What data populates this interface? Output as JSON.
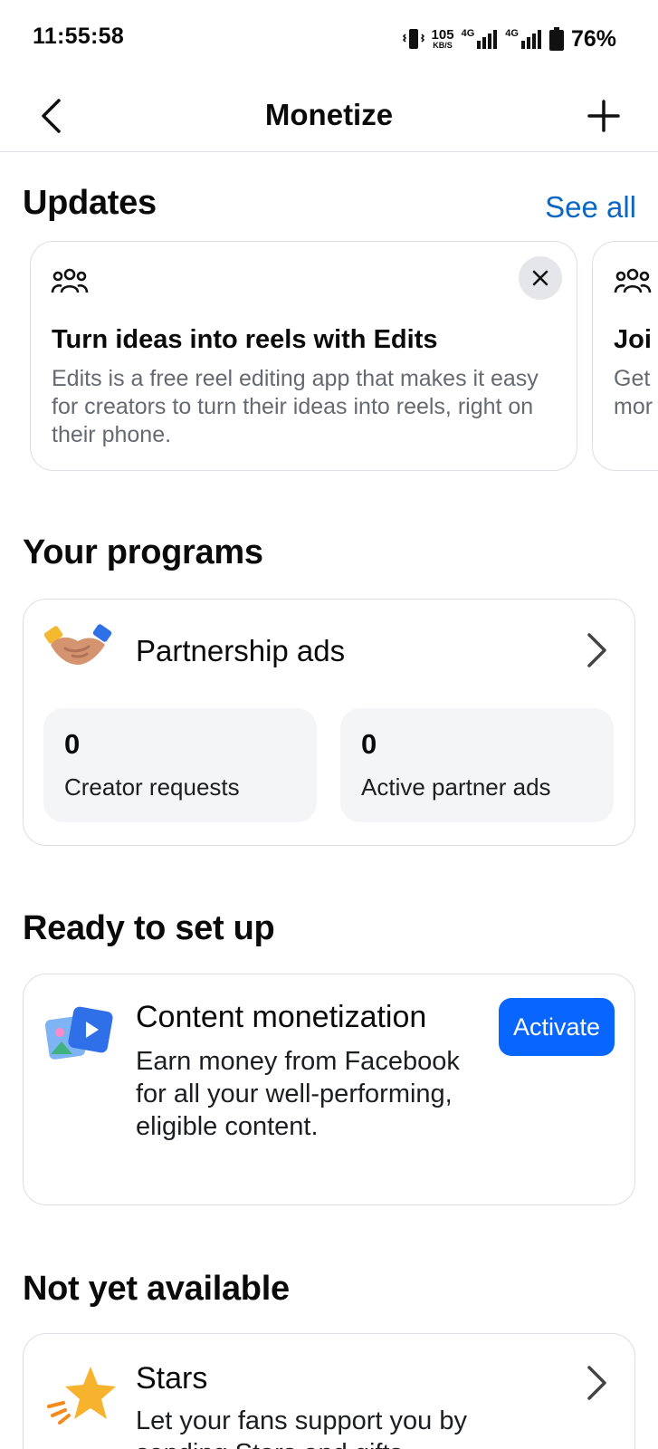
{
  "status_bar": {
    "time": "11:55:58",
    "net_speed_value": "105",
    "net_speed_unit": "KB/S",
    "signal1_label": "4G",
    "signal2_label": "4G",
    "battery_percent": "76%"
  },
  "header": {
    "title": "Monetize",
    "back_icon": "chevron-left-icon",
    "add_icon": "plus-icon"
  },
  "updates": {
    "heading": "Updates",
    "see_all_label": "See all",
    "cards": [
      {
        "icon": "group-icon",
        "title": "Turn ideas into reels with Edits",
        "body": "Edits is a free reel editing app that makes it easy for creators to turn their ideas into reels, right on their phone."
      },
      {
        "icon": "group-icon",
        "title": "Joi",
        "body_line1": "Get",
        "body_line2": "mor"
      }
    ]
  },
  "programs": {
    "heading": "Your programs",
    "items": [
      {
        "name": "Partnership ads",
        "icon": "handshake-icon",
        "stats": [
          {
            "value": "0",
            "label": "Creator requests"
          },
          {
            "value": "0",
            "label": "Active partner ads"
          }
        ]
      }
    ]
  },
  "ready": {
    "heading": "Ready to set up",
    "items": [
      {
        "title": "Content monetization",
        "icon": "content-media-icon",
        "description": "Earn money from Facebook for all your well-performing, eligible content.",
        "button_label": "Activate"
      }
    ]
  },
  "not_available": {
    "heading": "Not yet available",
    "items": [
      {
        "title": "Stars",
        "icon": "star-icon",
        "description": "Let your fans support you by sending Stars and gifts."
      }
    ]
  },
  "colors": {
    "accent_blue": "#0866ff",
    "link_blue": "#0a67c2",
    "card_border": "#dcdfe4",
    "tile_bg": "#f4f5f7"
  }
}
